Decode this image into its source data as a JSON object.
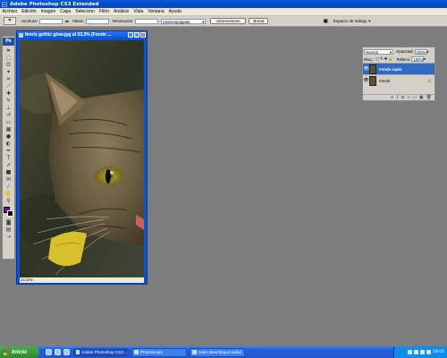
{
  "window": {
    "title": "Adobe Photoshop CS3 Extended",
    "app_icon": "Ps"
  },
  "menu": [
    "Archivo",
    "Edición",
    "Imagen",
    "Capa",
    "Selección",
    "Filtro",
    "Análisis",
    "Vista",
    "Ventana",
    "Ayuda"
  ],
  "options": {
    "width_label": "Anchura:",
    "height_label": "Altura:",
    "resolution_label": "Resolución:",
    "units_value": "píxeles/pulgada",
    "dimensions_button": "Dimensiones",
    "clear_button": "Borrar",
    "workspace_label": "Espacio de trabajo"
  },
  "toolbox": {
    "logo": "Ps",
    "foreground_color": "#7a0a9c",
    "background_color": "#000000"
  },
  "document": {
    "title": "fenris gothic glow.jpg al 33,3% (Fondo ...",
    "zoom": "33,33%"
  },
  "layers": {
    "blend_mode": "Normal",
    "opacity_label": "Opacidad:",
    "opacity_value": "100%",
    "lock_label": "Bloq.:",
    "fill_label": "Relleno:",
    "fill_value": "100%",
    "items": [
      {
        "name": "Fondo copia",
        "active": true
      },
      {
        "name": "Fondo",
        "active": false
      }
    ]
  },
  "taskbar": {
    "start_label": "Inicio",
    "tasks": [
      "Adobe Photoshop CS3 ...",
      "PhotoScape",
      "Gato desenfoque radial"
    ],
    "clock": "19:03"
  }
}
